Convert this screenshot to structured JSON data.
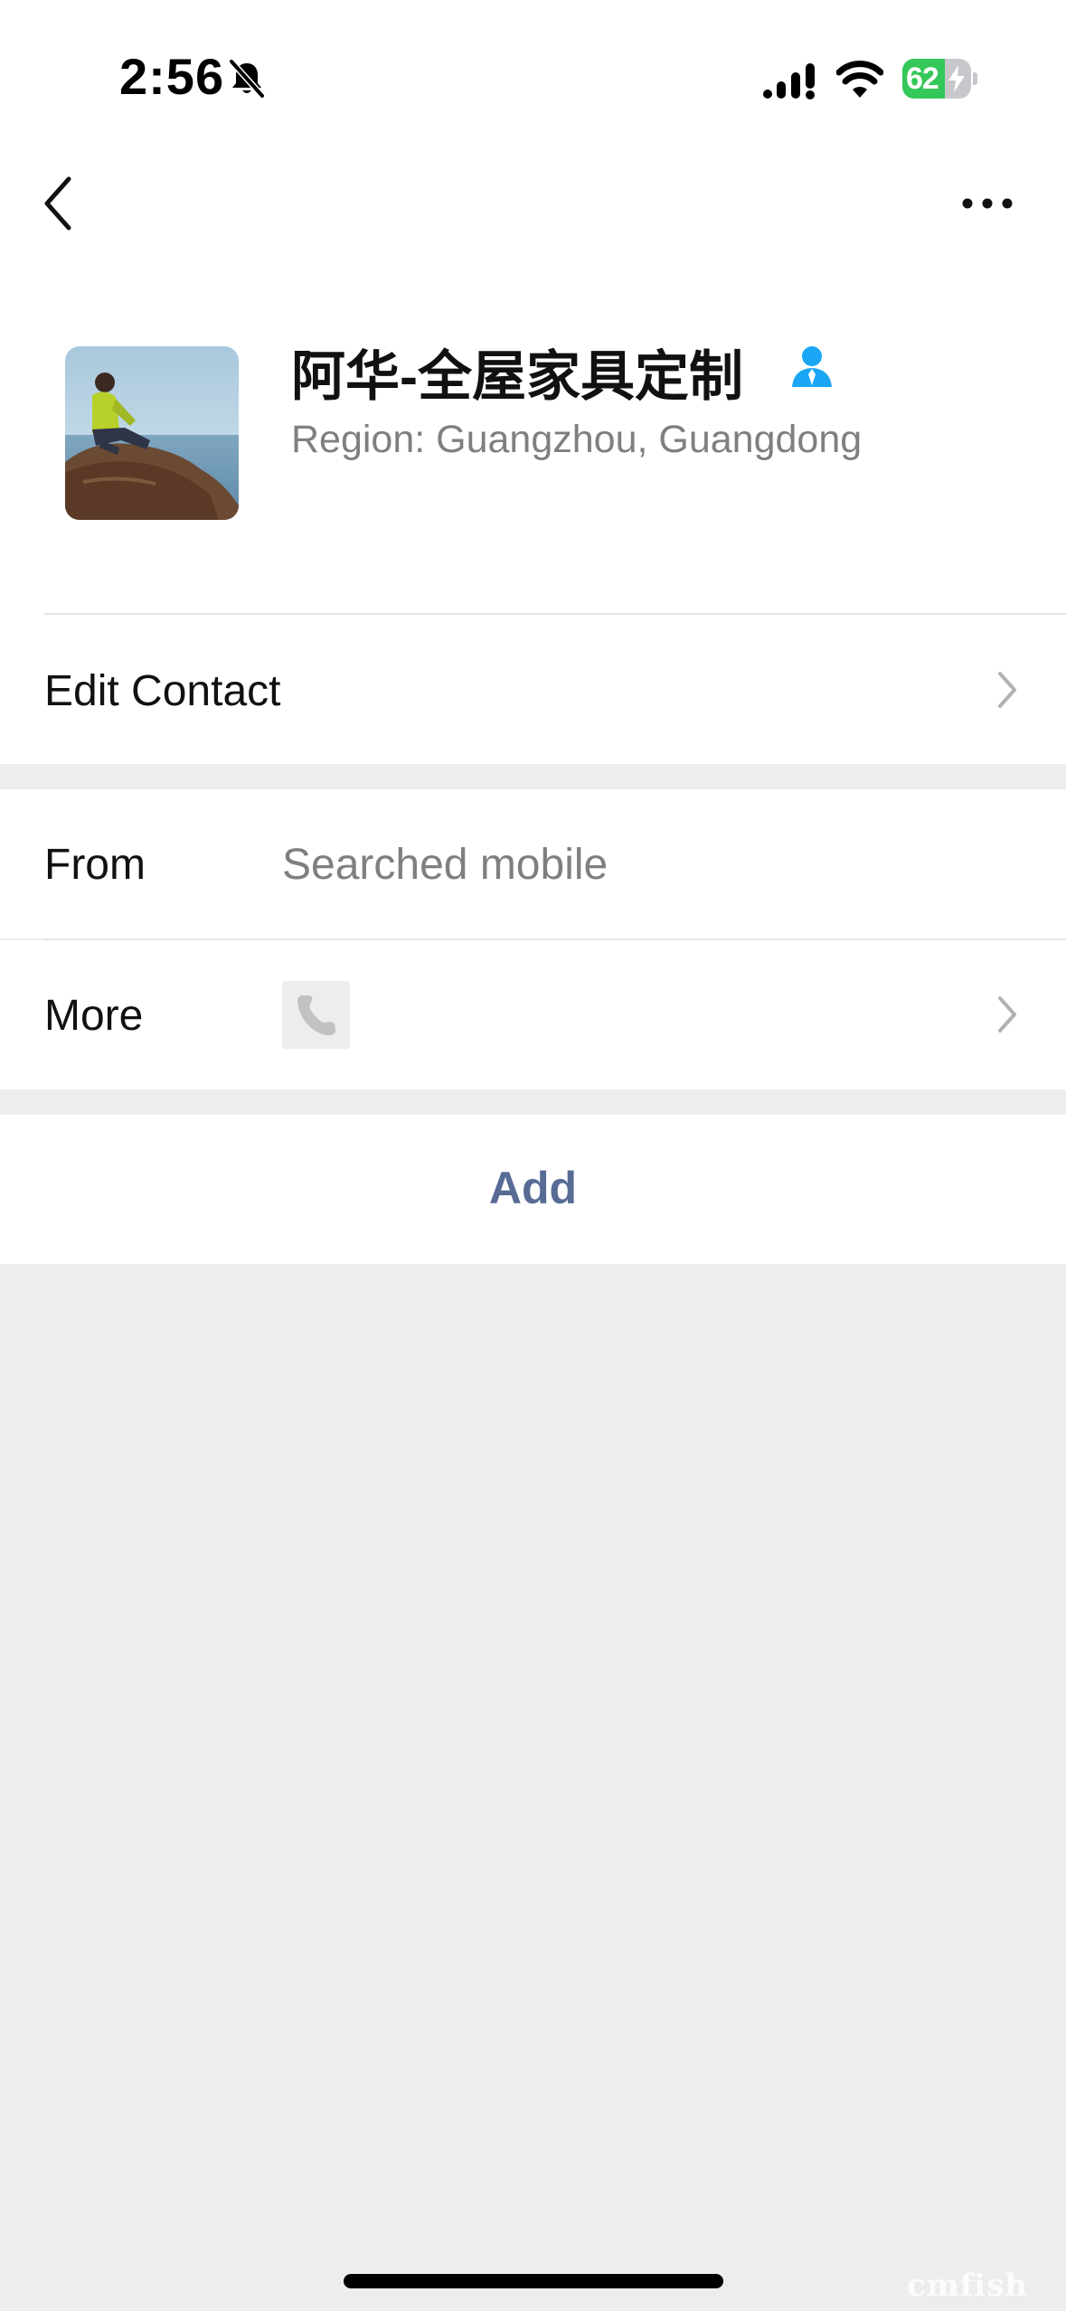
{
  "status_bar": {
    "time": "2:56",
    "battery_percent": 62,
    "battery_label": "62",
    "icons": [
      "bell-slash-icon",
      "cellular-signal-icon",
      "wifi-icon",
      "battery-charging-icon"
    ]
  },
  "nav": {
    "back_icon": "chevron-left-icon",
    "more_icon": "ellipsis-icon"
  },
  "profile": {
    "name": "阿华-全屋家具定制",
    "badge_icon": "person-badge-icon",
    "region": "Region: Guangzhou, Guangdong"
  },
  "rows": {
    "edit_contact": {
      "label": "Edit Contact"
    },
    "from": {
      "label": "From",
      "value": "Searched mobile"
    },
    "more": {
      "label": "More",
      "icon": "phone-icon"
    }
  },
  "actions": {
    "add_label": "Add"
  },
  "watermark": "cmfish",
  "colors": {
    "accent_link": "#576b95",
    "badge_blue": "#1aa6f5",
    "battery_green": "#34c759",
    "background": "#ededed"
  }
}
